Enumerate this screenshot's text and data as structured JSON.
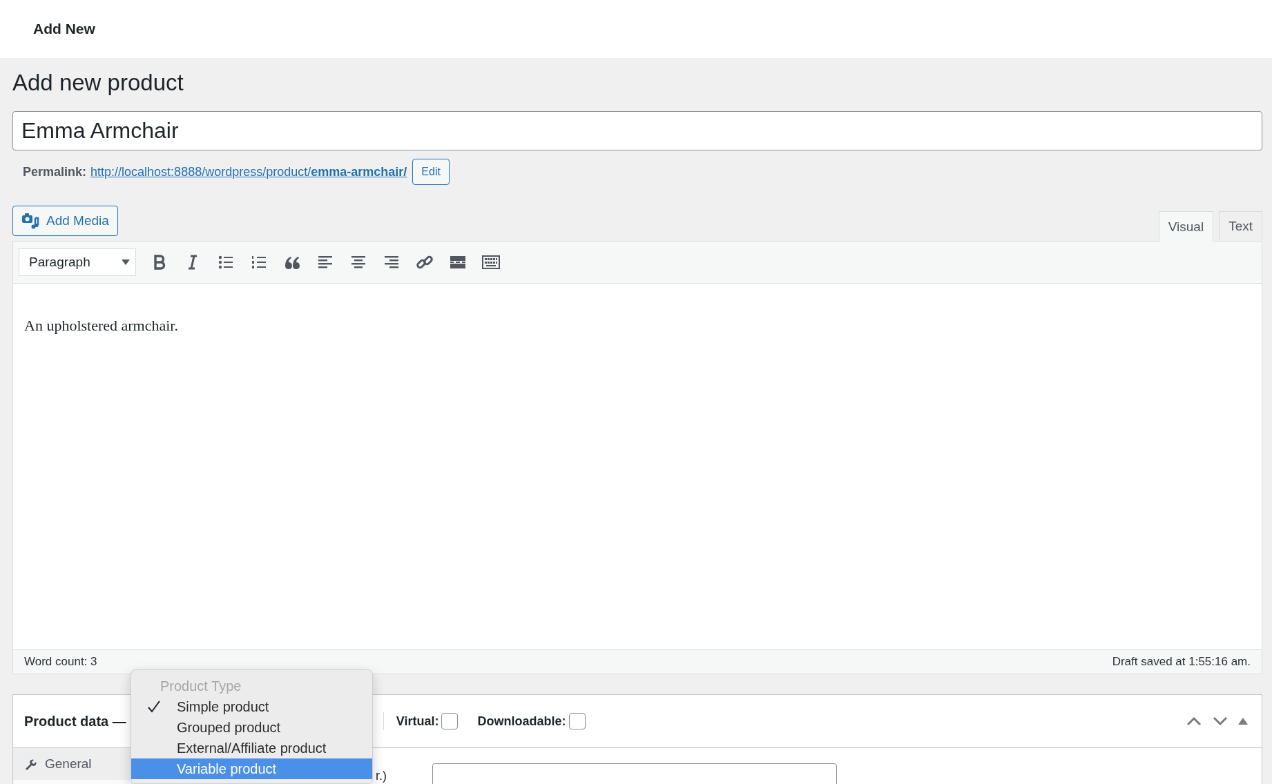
{
  "top_bar": {
    "title": "Add New"
  },
  "page_title": "Add new product",
  "product_name": {
    "value": "Emma Armchair"
  },
  "permalink": {
    "label": "Permalink:",
    "url_base": "http://localhost:8888/wordpress/product/",
    "url_slug": "emma-armchair/",
    "edit_button": "Edit"
  },
  "add_media_button": "Add Media",
  "editor_tabs": [
    {
      "label": "Visual",
      "selected": true
    },
    {
      "label": "Text",
      "selected": false
    }
  ],
  "format_select": {
    "value": "Paragraph"
  },
  "editor_content": "An upholstered armchair.",
  "status_bar": {
    "word_count": "Word count: 3",
    "draft_status": "Draft saved at 1:55:16 am."
  },
  "product_data": {
    "title": "Product data —",
    "options": [
      {
        "label": "Virtual:",
        "checked": false
      },
      {
        "label": "Downloadable:",
        "checked": false
      }
    ],
    "tabs": [
      {
        "label": "General",
        "selected": true
      }
    ],
    "field_label_fragment": "r.)"
  },
  "product_type_menu": {
    "header": "Product Type",
    "options": [
      {
        "label": "Simple product",
        "checked": true,
        "selected": false
      },
      {
        "label": "Grouped product",
        "checked": false,
        "selected": false
      },
      {
        "label": "External/Affiliate product",
        "checked": false,
        "selected": false
      },
      {
        "label": "Variable product",
        "checked": false,
        "selected": true
      }
    ]
  }
}
